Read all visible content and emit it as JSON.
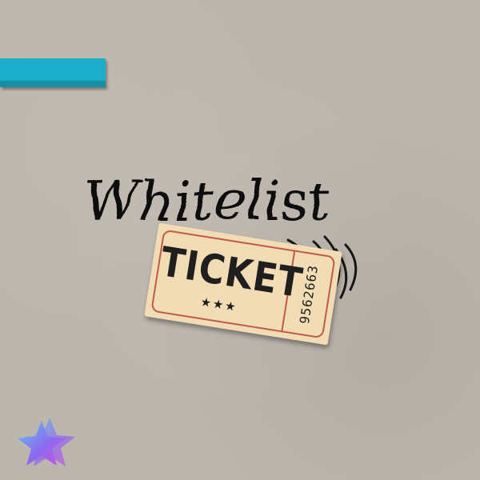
{
  "title": {
    "text": "Whitelist"
  },
  "ticket": {
    "label": "TICKET",
    "stars": "★★★",
    "number": "9562663"
  },
  "colors": {
    "background": "#bcb6ad",
    "accent": "#1aaecb",
    "ticket_paper": "#f1dcb5",
    "ticket_border": "#c25a4a",
    "title_ink": "#111111",
    "logo_gradient": [
      "#5ec8f2",
      "#8a6cf0",
      "#d24fe0"
    ]
  },
  "icons": {
    "logo": "star-logo-icon"
  }
}
